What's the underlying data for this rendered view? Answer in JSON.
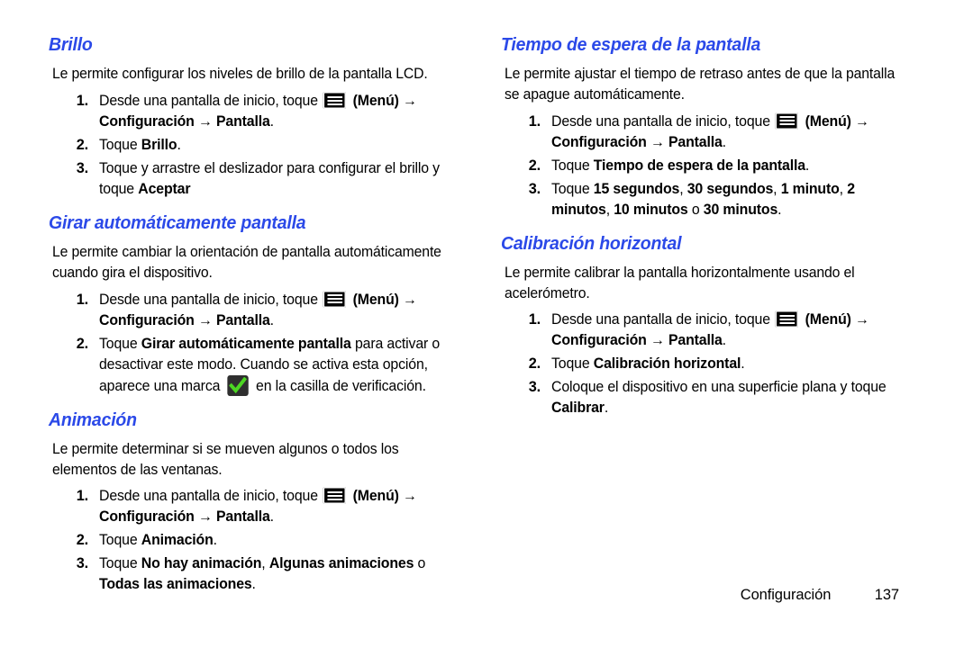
{
  "document": {
    "footer": {
      "section_label": "Configuración",
      "page_number": "137"
    },
    "heading_color": "#2b49e8",
    "icons": {
      "menu": "menu-icon",
      "checkbox_checked": "green-checkmark-icon"
    }
  },
  "columns": [
    {
      "id": "left",
      "sections": [
        {
          "heading": "Brillo",
          "intro": "Le permite configurar los niveles de brillo de la pantalla LCD.",
          "steps": [
            {
              "num": "1.",
              "parts": [
                {
                  "t": "text",
                  "v": "Desde una pantalla de inicio, toque "
                },
                {
                  "t": "icon",
                  "v": "menu-icon"
                },
                {
                  "t": "bold",
                  "v": " (Menú) "
                },
                {
                  "t": "arrow",
                  "v": "→"
                },
                {
                  "t": "text",
                  "v": " "
                },
                {
                  "t": "bold",
                  "v": "Configuración"
                },
                {
                  "t": "text",
                  "v": " "
                },
                {
                  "t": "arrow",
                  "v": "→"
                },
                {
                  "t": "text",
                  "v": " "
                },
                {
                  "t": "bold",
                  "v": "Pantalla"
                },
                {
                  "t": "text",
                  "v": "."
                }
              ]
            },
            {
              "num": "2.",
              "parts": [
                {
                  "t": "text",
                  "v": "Toque "
                },
                {
                  "t": "bold",
                  "v": "Brillo"
                },
                {
                  "t": "text",
                  "v": "."
                }
              ]
            },
            {
              "num": "3.",
              "parts": [
                {
                  "t": "text",
                  "v": "Toque y arrastre el deslizador para configurar el brillo y toque "
                },
                {
                  "t": "bold",
                  "v": "Aceptar"
                }
              ]
            }
          ]
        },
        {
          "heading": "Girar automáticamente pantalla",
          "intro": "Le permite cambiar la orientación de pantalla automáticamente cuando gira el dispositivo.",
          "steps": [
            {
              "num": "1.",
              "parts": [
                {
                  "t": "text",
                  "v": "Desde una pantalla de inicio, toque "
                },
                {
                  "t": "icon",
                  "v": "menu-icon"
                },
                {
                  "t": "bold",
                  "v": " (Menú) "
                },
                {
                  "t": "arrow",
                  "v": "→"
                },
                {
                  "t": "text",
                  "v": " "
                },
                {
                  "t": "bold",
                  "v": "Configuración"
                },
                {
                  "t": "text",
                  "v": " "
                },
                {
                  "t": "arrow",
                  "v": "→"
                },
                {
                  "t": "text",
                  "v": " "
                },
                {
                  "t": "bold",
                  "v": "Pantalla"
                },
                {
                  "t": "text",
                  "v": "."
                }
              ]
            },
            {
              "num": "2.",
              "parts": [
                {
                  "t": "text",
                  "v": "Toque "
                },
                {
                  "t": "bold",
                  "v": "Girar automáticamente pantalla"
                },
                {
                  "t": "text",
                  "v": " para activar o desactivar este modo. Cuando se activa esta opción, aparece una marca "
                },
                {
                  "t": "check",
                  "v": "green-checkmark-icon"
                },
                {
                  "t": "text",
                  "v": " en la casilla de verificación."
                }
              ]
            }
          ]
        },
        {
          "heading": "Animación",
          "intro": "Le permite determinar si se mueven algunos o todos los elementos de las ventanas.",
          "steps": [
            {
              "num": "1.",
              "parts": [
                {
                  "t": "text",
                  "v": "Desde una pantalla de inicio, toque "
                },
                {
                  "t": "icon",
                  "v": "menu-icon"
                },
                {
                  "t": "bold",
                  "v": " (Menú) "
                },
                {
                  "t": "arrow",
                  "v": "→"
                },
                {
                  "t": "text",
                  "v": " "
                },
                {
                  "t": "bold",
                  "v": "Configuración"
                },
                {
                  "t": "text",
                  "v": " "
                },
                {
                  "t": "arrow",
                  "v": "→"
                },
                {
                  "t": "text",
                  "v": " "
                },
                {
                  "t": "bold",
                  "v": "Pantalla"
                },
                {
                  "t": "text",
                  "v": "."
                }
              ]
            },
            {
              "num": "2.",
              "parts": [
                {
                  "t": "text",
                  "v": "Toque "
                },
                {
                  "t": "bold",
                  "v": "Animación"
                },
                {
                  "t": "text",
                  "v": "."
                }
              ]
            },
            {
              "num": "3.",
              "parts": [
                {
                  "t": "text",
                  "v": "Toque "
                },
                {
                  "t": "bold",
                  "v": "No hay animación"
                },
                {
                  "t": "text",
                  "v": ", "
                },
                {
                  "t": "bold",
                  "v": "Algunas animaciones"
                },
                {
                  "t": "text",
                  "v": " o "
                },
                {
                  "t": "bold",
                  "v": "Todas las animaciones"
                },
                {
                  "t": "text",
                  "v": "."
                }
              ]
            }
          ]
        }
      ]
    },
    {
      "id": "right",
      "sections": [
        {
          "heading": "Tiempo de espera de la pantalla",
          "intro": "Le permite ajustar el tiempo de retraso antes de que la pantalla se apague automáticamente.",
          "steps": [
            {
              "num": "1.",
              "parts": [
                {
                  "t": "text",
                  "v": "Desde una pantalla de inicio, toque "
                },
                {
                  "t": "icon",
                  "v": "menu-icon"
                },
                {
                  "t": "bold",
                  "v": " (Menú) "
                },
                {
                  "t": "arrow",
                  "v": "→"
                },
                {
                  "t": "text",
                  "v": " "
                },
                {
                  "t": "bold",
                  "v": "Configuración"
                },
                {
                  "t": "text",
                  "v": " "
                },
                {
                  "t": "arrow",
                  "v": "→"
                },
                {
                  "t": "text",
                  "v": " "
                },
                {
                  "t": "bold",
                  "v": "Pantalla"
                },
                {
                  "t": "text",
                  "v": "."
                }
              ]
            },
            {
              "num": "2.",
              "parts": [
                {
                  "t": "text",
                  "v": "Toque "
                },
                {
                  "t": "bold",
                  "v": "Tiempo de espera de la pantalla"
                },
                {
                  "t": "text",
                  "v": "."
                }
              ]
            },
            {
              "num": "3.",
              "parts": [
                {
                  "t": "text",
                  "v": "Toque "
                },
                {
                  "t": "bold",
                  "v": "15 segundos"
                },
                {
                  "t": "text",
                  "v": ", "
                },
                {
                  "t": "bold",
                  "v": "30 segundos"
                },
                {
                  "t": "text",
                  "v": ", "
                },
                {
                  "t": "bold",
                  "v": "1 minuto"
                },
                {
                  "t": "text",
                  "v": ", "
                },
                {
                  "t": "bold",
                  "v": "2 minutos"
                },
                {
                  "t": "text",
                  "v": ", "
                },
                {
                  "t": "bold",
                  "v": "10 minutos"
                },
                {
                  "t": "text",
                  "v": " o "
                },
                {
                  "t": "bold",
                  "v": "30 minutos"
                },
                {
                  "t": "text",
                  "v": "."
                }
              ]
            }
          ]
        },
        {
          "heading": "Calibración horizontal",
          "intro": "Le permite calibrar la pantalla horizontalmente usando el acelerómetro.",
          "steps": [
            {
              "num": "1.",
              "parts": [
                {
                  "t": "text",
                  "v": "Desde una pantalla de inicio, toque "
                },
                {
                  "t": "icon",
                  "v": "menu-icon"
                },
                {
                  "t": "bold",
                  "v": " (Menú) "
                },
                {
                  "t": "arrow",
                  "v": "→"
                },
                {
                  "t": "text",
                  "v": " "
                },
                {
                  "t": "bold",
                  "v": "Configuración"
                },
                {
                  "t": "text",
                  "v": " "
                },
                {
                  "t": "arrow",
                  "v": "→"
                },
                {
                  "t": "text",
                  "v": " "
                },
                {
                  "t": "bold",
                  "v": "Pantalla"
                },
                {
                  "t": "text",
                  "v": "."
                }
              ]
            },
            {
              "num": "2.",
              "parts": [
                {
                  "t": "text",
                  "v": "Toque "
                },
                {
                  "t": "bold",
                  "v": "Calibración horizontal"
                },
                {
                  "t": "text",
                  "v": "."
                }
              ]
            },
            {
              "num": "3.",
              "parts": [
                {
                  "t": "text",
                  "v": "Coloque el dispositivo en una superficie plana y toque "
                },
                {
                  "t": "bold",
                  "v": "Calibrar"
                },
                {
                  "t": "text",
                  "v": "."
                }
              ]
            }
          ]
        }
      ]
    }
  ]
}
